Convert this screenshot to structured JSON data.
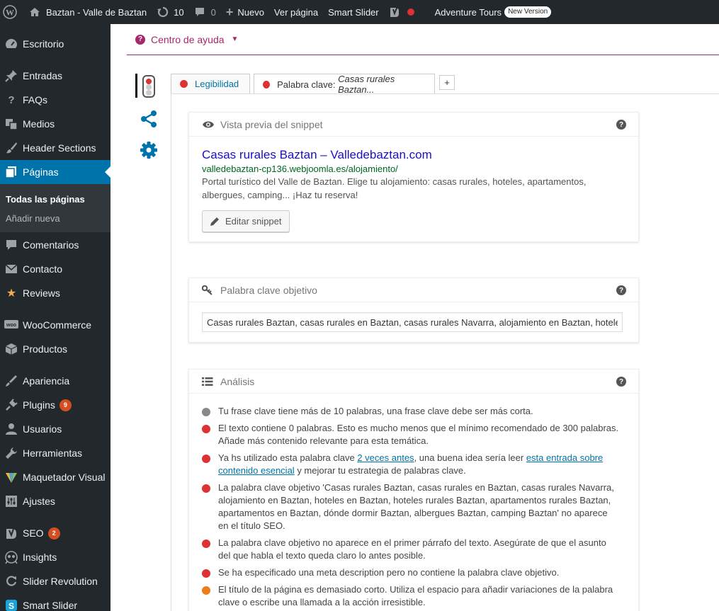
{
  "admin_bar": {
    "site_name": "Baztan - Valle de Baztan",
    "updates_count": "10",
    "comments_count": "0",
    "new_label": "Nuevo",
    "view_page": "Ver página",
    "smart_slider": "Smart Slider",
    "adventure_tours": "Adventure Tours",
    "new_version_badge": "New Version"
  },
  "sidebar": {
    "items": [
      {
        "label": "Escritorio",
        "icon": "dashboard-icon"
      },
      {
        "label": "Entradas",
        "icon": "pin-icon"
      },
      {
        "label": "FAQs",
        "icon": "question-icon"
      },
      {
        "label": "Medios",
        "icon": "media-icon"
      },
      {
        "label": "Header Sections",
        "icon": "brush-icon"
      },
      {
        "label": "Páginas",
        "icon": "pages-icon"
      },
      {
        "label": "Comentarios",
        "icon": "comment-icon"
      },
      {
        "label": "Contacto",
        "icon": "mail-icon"
      },
      {
        "label": "Reviews",
        "icon": "star-icon"
      },
      {
        "label": "WooCommerce",
        "icon": "woocommerce-icon"
      },
      {
        "label": "Productos",
        "icon": "box-icon"
      },
      {
        "label": "Apariencia",
        "icon": "appearance-icon"
      },
      {
        "label": "Plugins",
        "icon": "plugin-icon",
        "badge": "9"
      },
      {
        "label": "Usuarios",
        "icon": "user-icon"
      },
      {
        "label": "Herramientas",
        "icon": "wrench-icon"
      },
      {
        "label": "Maquetador Visual",
        "icon": "visual-builder-icon"
      },
      {
        "label": "Ajustes",
        "icon": "settings-icon"
      },
      {
        "label": "SEO",
        "icon": "yoast-icon",
        "badge": "2"
      },
      {
        "label": "Insights",
        "icon": "insights-icon"
      },
      {
        "label": "Slider Revolution",
        "icon": "refresh-icon"
      },
      {
        "label": "Smart Slider",
        "icon": "smart-slider-icon"
      }
    ],
    "submenu": {
      "all_pages": "Todas las páginas",
      "add_new": "Añadir nueva"
    }
  },
  "help": {
    "label": "Centro de ayuda"
  },
  "tabs": {
    "readability": "Legibilidad",
    "keyword_prefix": "Palabra clave: ",
    "keyword_value": "Casas rurales Baztan...",
    "add": "+"
  },
  "snippet": {
    "heading": "Vista previa del snippet",
    "title": "Casas rurales Baztan – Valledebaztan.com",
    "url": "valledebaztan-cp136.webjoomla.es/alojamiento/",
    "description": "Portal turístico del Valle de Baztan. Elige tu alojamiento: casas rurales, hoteles, apartamentos, albergues, camping... ¡Haz tu reserva!",
    "edit_button": "Editar snippet"
  },
  "focus_keyword": {
    "heading": "Palabra clave objetivo",
    "value": "Casas rurales Baztan, casas rurales en Baztan, casas rurales Navarra, alojamiento en Baztan, hoteles rurales Baztan"
  },
  "analysis": {
    "heading": "Análisis",
    "items": [
      {
        "color": "#888888",
        "text": "Tu frase clave tiene más de 10 palabras, una frase clave debe ser más corta."
      },
      {
        "color": "#dc3232",
        "text": "El texto contiene 0 palabras. Esto es mucho menos que el mínimo recomendado de 300 palabras. Añade más contenido relevante para esta temática."
      },
      {
        "color": "#dc3232",
        "parts": [
          "Ya hs utilizado esta palabra clave ",
          "2 veces antes",
          ", una buena idea sería leer ",
          "esta entrada sobre contenido esencial",
          " y mejorar tu estrategia de palabras clave."
        ]
      },
      {
        "color": "#dc3232",
        "text": "La palabra clave objetivo 'Casas rurales Baztan, casas rurales en Baztan, casas rurales Navarra, alojamiento en Baztan, hoteles en Baztan, hoteles rurales Baztan, apartamentos rurales Baztan, apartamentos en Baztan, dónde dormir Baztan, albergues Baztan, camping Baztan' no aparece en el título SEO."
      },
      {
        "color": "#dc3232",
        "text": "La palabra clave objetivo no aparece en el primer párrafo del texto. Asegúrate de que el asunto del que habla el texto queda claro lo antes posible."
      },
      {
        "color": "#dc3232",
        "text": "Se ha especificado una meta description pero no contiene la palabra clave objetivo."
      },
      {
        "color": "#ee7c1b",
        "text": "El título de la página es demasiado corto. Utiliza el espacio para añadir variaciones de la palabra clave o escribe una llamada a la acción irresistible."
      }
    ]
  }
}
